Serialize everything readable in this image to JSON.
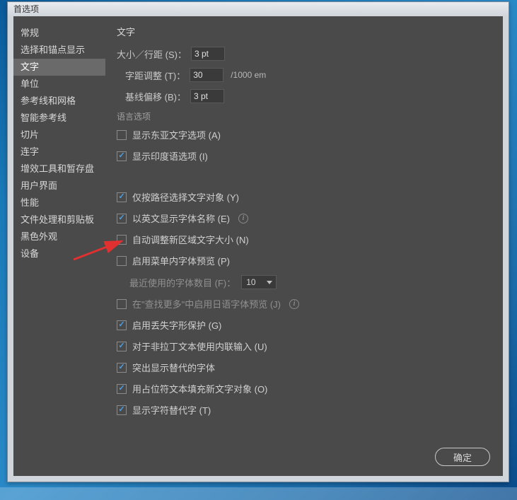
{
  "window": {
    "title": "首选项"
  },
  "sidebar": {
    "items": [
      {
        "label": "常规"
      },
      {
        "label": "选择和锚点显示"
      },
      {
        "label": "文字",
        "active": true
      },
      {
        "label": "单位"
      },
      {
        "label": "参考线和网格"
      },
      {
        "label": "智能参考线"
      },
      {
        "label": "切片"
      },
      {
        "label": "连字"
      },
      {
        "label": "增效工具和暂存盘"
      },
      {
        "label": "用户界面"
      },
      {
        "label": "性能"
      },
      {
        "label": "文件处理和剪贴板"
      },
      {
        "label": "黑色外观"
      },
      {
        "label": "设备"
      }
    ]
  },
  "main": {
    "title": "文字",
    "size_leading": {
      "label": "大小／行距 (S)：",
      "value": "3 pt"
    },
    "tracking": {
      "label": "字距调整 (T)：",
      "value": "30",
      "unit": "/1000 em"
    },
    "baseline": {
      "label": "基线偏移 (B)：",
      "value": "3 pt"
    },
    "lang_section": "语言选项",
    "lang_east_asian": {
      "label": "显示东亚文字选项 (A)",
      "checked": false
    },
    "lang_indic": {
      "label": "显示印度语选项 (I)",
      "checked": true
    },
    "opts": [
      {
        "label": "仅按路径选择文字对象 (Y)",
        "checked": true,
        "info": false
      },
      {
        "label": "以英文显示字体名称 (E)",
        "checked": true,
        "info": true
      },
      {
        "label": "自动调整新区域文字大小 (N)",
        "checked": false,
        "info": false
      },
      {
        "label": "启用菜单内字体预览 (P)",
        "checked": false,
        "info": false
      }
    ],
    "recent_fonts": {
      "label": "最近使用的字体数目 (F)：",
      "value": "10"
    },
    "opts2": [
      {
        "label": "在\"查找更多\"中启用日语字体预览 (J)",
        "checked": false,
        "dim": true,
        "info": true
      },
      {
        "label": "启用丢失字形保护 (G)",
        "checked": true
      },
      {
        "label": "对于非拉丁文本使用内联输入 (U)",
        "checked": true
      },
      {
        "label": "突出显示替代的字体",
        "checked": true
      },
      {
        "label": "用占位符文本填充新文字对象 (O)",
        "checked": true
      },
      {
        "label": "显示字符替代字 (T)",
        "checked": true
      }
    ],
    "ok": "确定"
  }
}
